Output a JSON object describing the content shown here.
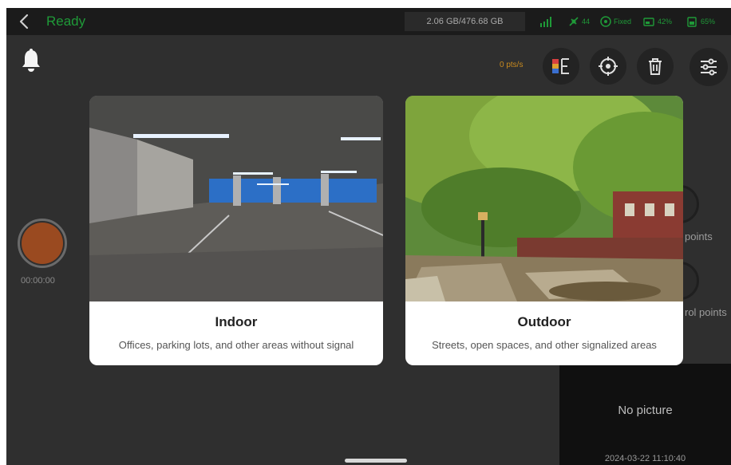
{
  "status_bar": {
    "title": "Ready",
    "storage": "2.06 GB/476.68 GB",
    "satellites": "44",
    "fix": "Fixed",
    "controller_battery": "42%",
    "battery": "65%"
  },
  "toolbar": {
    "points_rate": "0 pts/s"
  },
  "recording": {
    "time": "00:00:00"
  },
  "side_panel": {
    "points_label": "points",
    "control_points_label": "rol points"
  },
  "picture_panel": {
    "no_picture": "No picture",
    "timestamp": "2024-03-22 11:10:40"
  },
  "scene_dialog": {
    "options": [
      {
        "title": "Indoor",
        "description": "Offices, parking lots, and other areas without signal"
      },
      {
        "title": "Outdoor",
        "description": "Streets, open spaces, and other signalized areas"
      }
    ]
  },
  "colors": {
    "status_green": "#1f9a38",
    "record_brown": "#9a4a20",
    "rate_orange": "#c88a1f",
    "screen_bg": "#2f2f2f"
  }
}
